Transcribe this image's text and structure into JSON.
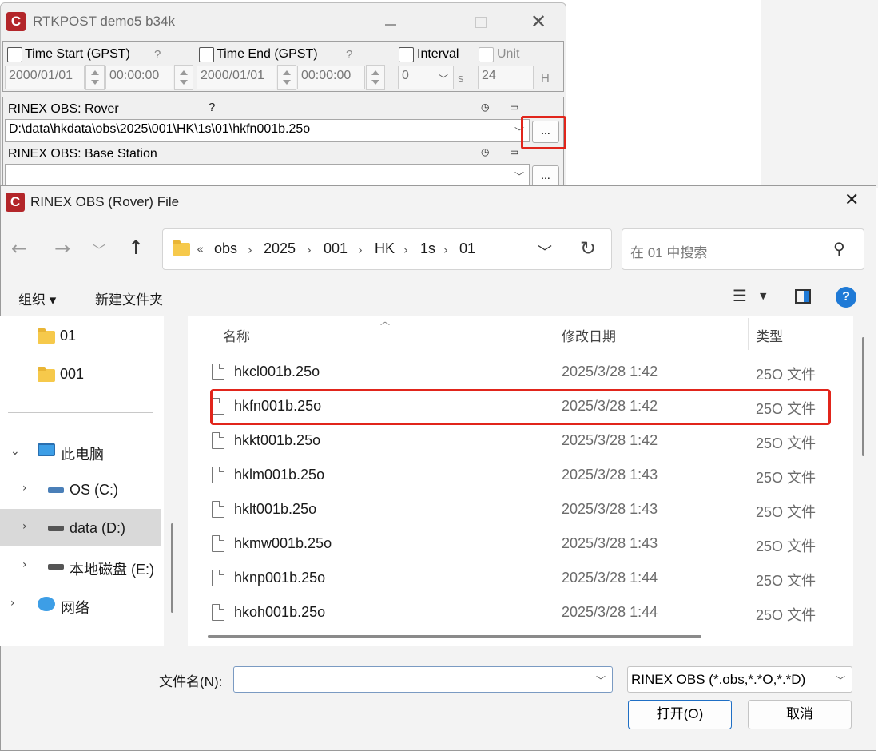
{
  "rtkpost": {
    "title": "RTKPOST demo5 b34k",
    "app_icon_letter": "C",
    "time_start_label": "Time Start (GPST)",
    "time_end_label": "Time End (GPST)",
    "question_mark": "?",
    "start_date": "2000/01/01",
    "start_time": "00:00:00",
    "end_date": "2000/01/01",
    "end_time": "00:00:00",
    "interval_label": "Interval",
    "interval_value": "0",
    "interval_unit": "s",
    "unit_label": "Unit",
    "unit_value": "24",
    "unit_suffix": "H",
    "rover_label": "RINEX OBS: Rover",
    "rover_path": "D:\\data\\hkdata\\obs\\2025\\001\\HK\\1s\\01\\hkfn001b.25o",
    "base_label": "RINEX OBS: Base Station",
    "base_path": "",
    "browse_label": "..."
  },
  "dialog": {
    "title": "RINEX OBS (Rover) File",
    "app_icon_letter": "C",
    "breadcrumb_prefix": "«",
    "breadcrumb": [
      "obs",
      "2025",
      "001",
      "HK",
      "1s",
      "01"
    ],
    "search_placeholder": "在 01 中搜索",
    "toolbar": {
      "organize": "组织 ▾",
      "new_folder": "新建文件夹"
    },
    "help_label": "?",
    "nav": {
      "folders": [
        "01",
        "001"
      ],
      "this_pc": "此电脑",
      "drives": [
        "OS (C:)",
        "data (D:)",
        "本地磁盘 (E:)"
      ],
      "network": "网络"
    },
    "columns": {
      "name": "名称",
      "modified": "修改日期",
      "type": "类型"
    },
    "files": [
      {
        "name": "hkcl001b.25o",
        "modified": "2025/3/28 1:42",
        "type": "25O 文件"
      },
      {
        "name": "hkfn001b.25o",
        "modified": "2025/3/28 1:42",
        "type": "25O 文件"
      },
      {
        "name": "hkkt001b.25o",
        "modified": "2025/3/28 1:42",
        "type": "25O 文件"
      },
      {
        "name": "hklm001b.25o",
        "modified": "2025/3/28 1:43",
        "type": "25O 文件"
      },
      {
        "name": "hklt001b.25o",
        "modified": "2025/3/28 1:43",
        "type": "25O 文件"
      },
      {
        "name": "hkmw001b.25o",
        "modified": "2025/3/28 1:43",
        "type": "25O 文件"
      },
      {
        "name": "hknp001b.25o",
        "modified": "2025/3/28 1:44",
        "type": "25O 文件"
      },
      {
        "name": "hkoh001b.25o",
        "modified": "2025/3/28 1:44",
        "type": "25O 文件"
      }
    ],
    "filename_label": "文件名(N):",
    "filename_value": "",
    "filter_value": "RINEX OBS (*.obs,*.*O,*.*D)",
    "open_label": "打开(O)",
    "cancel_label": "取消"
  },
  "colors": {
    "highlight": "#e1251b",
    "accent": "#1f7ad6",
    "app_icon": "#b3262a"
  },
  "icons": [
    "app-icon",
    "back-arrow-icon",
    "forward-arrow-icon",
    "chevron-down-icon",
    "up-arrow-icon",
    "refresh-icon",
    "search-icon",
    "view-list-icon",
    "preview-pane-icon",
    "help-icon",
    "folder-icon",
    "computer-icon",
    "drive-icon",
    "network-icon",
    "file-icon",
    "close-icon"
  ]
}
